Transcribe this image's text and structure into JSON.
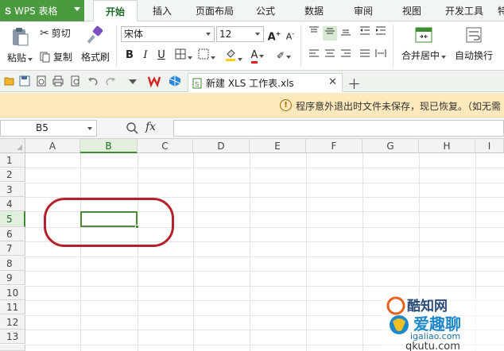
{
  "app": {
    "logo": "S",
    "name": "WPS 表格"
  },
  "menu": {
    "tabs": [
      "开始",
      "插入",
      "页面布局",
      "公式",
      "数据",
      "审阅",
      "视图",
      "开发工具",
      "特"
    ],
    "active": "开始"
  },
  "ribbon": {
    "paste": "粘贴",
    "cut": "剪切",
    "copy": "复制",
    "format_painter": "格式刷",
    "font_name": "宋体",
    "font_size": "12",
    "bold": "B",
    "italic": "I",
    "underline": "U",
    "font_grow": "A",
    "font_shrink": "A",
    "font_color_letter": "A",
    "merge_center": "合并居中",
    "wrap_text": "自动换行"
  },
  "document": {
    "tab_title": "新建 XLS 工作表.xls"
  },
  "notice": {
    "text": "程序意外退出时文件未保存，现已恢复。（如无需"
  },
  "formula_bar": {
    "name_box": "B5",
    "fx_label": "fx",
    "value": ""
  },
  "sheet": {
    "columns": [
      "A",
      "B",
      "C",
      "D",
      "E",
      "F",
      "G",
      "H",
      "I"
    ],
    "rows": [
      "1",
      "2",
      "3",
      "4",
      "5",
      "6",
      "7",
      "8",
      "9",
      "10",
      "11",
      "12",
      "13"
    ],
    "selected_column": "B",
    "selected_row": "5"
  },
  "watermark": {
    "brand": "爱趣聊",
    "url1": "igaliao.com",
    "url2": "qkutu.com",
    "partial": "酷知网"
  },
  "colors": {
    "accent": "#4a9a3f",
    "selection": "#4b8a3a",
    "highlight_circle": "#b3212c",
    "notice_bg": "#fde9bb"
  }
}
